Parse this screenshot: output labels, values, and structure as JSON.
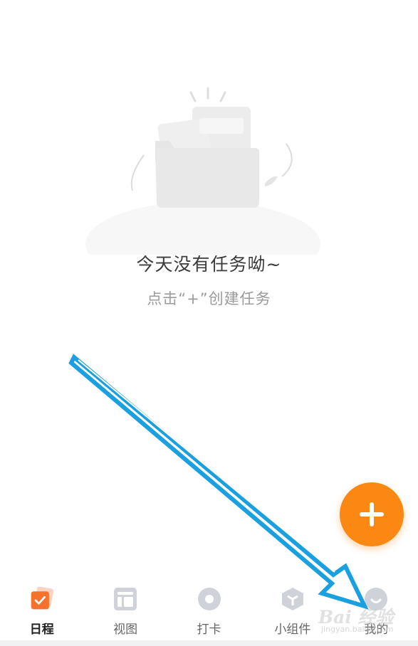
{
  "empty_state": {
    "title": "今天没有任务呦~",
    "subtitle": "点击“+”创建任务"
  },
  "fab": {
    "icon": "plus-icon",
    "color": "#fb8812"
  },
  "tabbar": {
    "tabs": [
      {
        "label": "日程",
        "icon": "schedule-icon",
        "active": true
      },
      {
        "label": "视图",
        "icon": "view-layout-icon",
        "active": false
      },
      {
        "label": "打卡",
        "icon": "check-in-icon",
        "active": false
      },
      {
        "label": "小组件",
        "icon": "widget-cube-icon",
        "active": false
      },
      {
        "label": "我的",
        "icon": "profile-smile-icon",
        "active": false
      }
    ]
  },
  "watermark": {
    "text": "Bai 经验",
    "sub": "jingyan.baidu.com"
  },
  "colors": {
    "accent": "#fb8812",
    "annotation_arrow": "#1aa0e0"
  }
}
